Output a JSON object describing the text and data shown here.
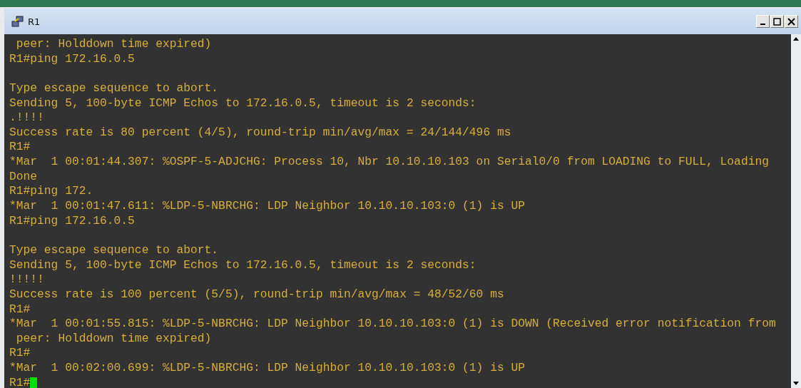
{
  "window": {
    "title": "R1"
  },
  "terminal": {
    "lines": [
      {
        "kind": "text",
        "text": " peer: Holddown time expired)"
      },
      {
        "kind": "text",
        "text": "R1#ping 172.16.0.5"
      },
      {
        "kind": "blank"
      },
      {
        "kind": "text",
        "text": "Type escape sequence to abort."
      },
      {
        "kind": "text",
        "text": "Sending 5, 100-byte ICMP Echos to 172.16.0.5, timeout is 2 seconds:"
      },
      {
        "kind": "text",
        "text": ".!!!!"
      },
      {
        "kind": "text",
        "text": "Success rate is 80 percent (4/5), round-trip min/avg/max = 24/144/496 ms"
      },
      {
        "kind": "text",
        "text": "R1#"
      },
      {
        "kind": "text",
        "text": "*Mar  1 00:01:44.307: %OSPF-5-ADJCHG: Process 10, Nbr 10.10.10.103 on Serial0/0 from LOADING to FULL, Loading"
      },
      {
        "kind": "text",
        "text": "Done"
      },
      {
        "kind": "text",
        "text": "R1#ping 172."
      },
      {
        "kind": "text",
        "text": "*Mar  1 00:01:47.611: %LDP-5-NBRCHG: LDP Neighbor 10.10.10.103:0 (1) is UP"
      },
      {
        "kind": "text",
        "text": "R1#ping 172.16.0.5"
      },
      {
        "kind": "blank"
      },
      {
        "kind": "text",
        "text": "Type escape sequence to abort."
      },
      {
        "kind": "text",
        "text": "Sending 5, 100-byte ICMP Echos to 172.16.0.5, timeout is 2 seconds:"
      },
      {
        "kind": "text",
        "text": "!!!!!"
      },
      {
        "kind": "text",
        "text": "Success rate is 100 percent (5/5), round-trip min/avg/max = 48/52/60 ms"
      },
      {
        "kind": "text",
        "text": "R1#"
      },
      {
        "kind": "text",
        "text": "*Mar  1 00:01:55.815: %LDP-5-NBRCHG: LDP Neighbor 10.10.10.103:0 (1) is DOWN (Received error notification from"
      },
      {
        "kind": "text",
        "text": " peer: Holddown time expired)"
      },
      {
        "kind": "text",
        "text": "R1#"
      },
      {
        "kind": "text",
        "text": "*Mar  1 00:02:00.699: %LDP-5-NBRCHG: LDP Neighbor 10.10.10.103:0 (1) is UP"
      },
      {
        "kind": "prompt",
        "text": "R1#"
      }
    ]
  }
}
